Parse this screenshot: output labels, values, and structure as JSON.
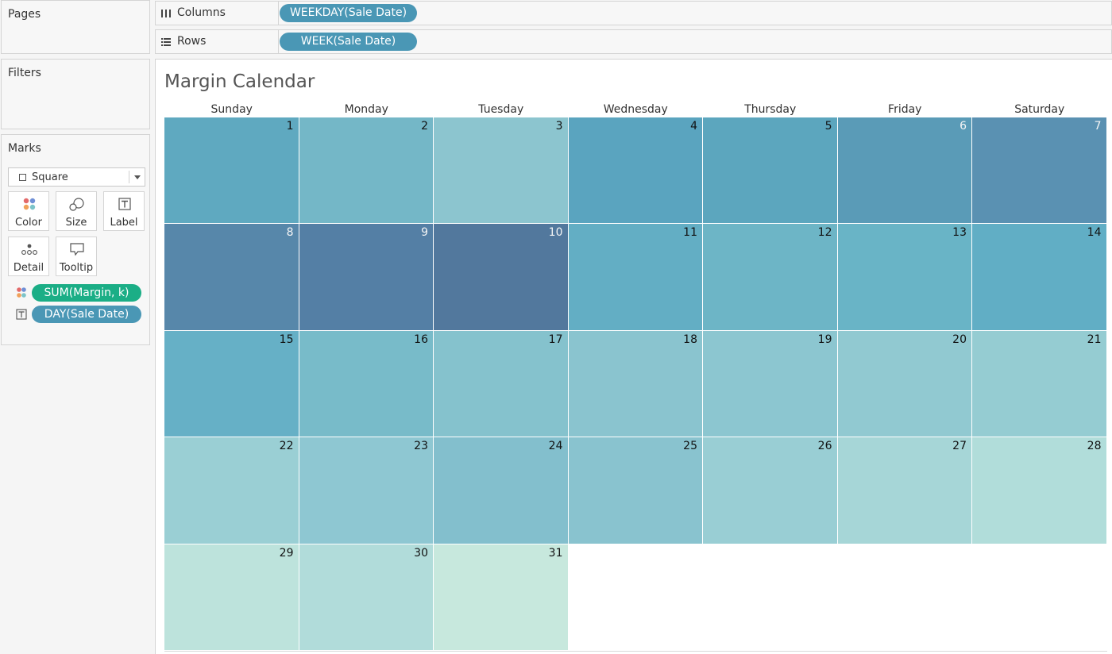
{
  "sidebar": {
    "pages_title": "Pages",
    "filters_title": "Filters",
    "marks_title": "Marks",
    "mark_type": "Square",
    "mark_buttons": [
      {
        "label": "Color",
        "icon": "color-dots-icon"
      },
      {
        "label": "Size",
        "icon": "size-circles-icon"
      },
      {
        "label": "Label",
        "icon": "label-t-icon"
      },
      {
        "label": "Detail",
        "icon": "detail-dots-icon"
      },
      {
        "label": "Tooltip",
        "icon": "tooltip-bubble-icon"
      }
    ],
    "mark_fields": [
      {
        "label": "SUM(Margin, k)",
        "icon": "color-dots-icon",
        "color": "#1bae86"
      },
      {
        "label": "DAY(Sale Date)",
        "icon": "label-t-icon",
        "color": "#4a97b5"
      }
    ]
  },
  "shelves": {
    "columns_label": "Columns",
    "columns_pill": "WEEKDAY(Sale Date)",
    "rows_label": "Rows",
    "rows_pill": "WEEK(Sale Date)"
  },
  "viz": {
    "title": "Margin Calendar",
    "weekdays": [
      "Sunday",
      "Monday",
      "Tuesday",
      "Wednesday",
      "Thursday",
      "Friday",
      "Saturday"
    ],
    "days": [
      {
        "day": "1",
        "color": "#5fa9c0"
      },
      {
        "day": "2",
        "color": "#74b7c7"
      },
      {
        "day": "3",
        "color": "#8cc5cf"
      },
      {
        "day": "4",
        "color": "#5aa4bf"
      },
      {
        "day": "5",
        "color": "#5ca6be"
      },
      {
        "day": "6",
        "color": "#5a9bb7"
      },
      {
        "day": "7",
        "color": "#5a91b2"
      },
      {
        "day": "8",
        "color": "#5787aa"
      },
      {
        "day": "9",
        "color": "#547fa5"
      },
      {
        "day": "10",
        "color": "#52789d"
      },
      {
        "day": "11",
        "color": "#63aec4"
      },
      {
        "day": "12",
        "color": "#6db5c6"
      },
      {
        "day": "13",
        "color": "#69b4c6"
      },
      {
        "day": "14",
        "color": "#61aec5"
      },
      {
        "day": "15",
        "color": "#66b0c6"
      },
      {
        "day": "16",
        "color": "#78bbc9"
      },
      {
        "day": "17",
        "color": "#85c2cd"
      },
      {
        "day": "18",
        "color": "#8ac4cf"
      },
      {
        "day": "19",
        "color": "#8cc6d0"
      },
      {
        "day": "20",
        "color": "#91c9d1"
      },
      {
        "day": "21",
        "color": "#95ccd2"
      },
      {
        "day": "22",
        "color": "#9acfd4"
      },
      {
        "day": "23",
        "color": "#8ec7d2"
      },
      {
        "day": "24",
        "color": "#83bfcd"
      },
      {
        "day": "25",
        "color": "#89c3cf"
      },
      {
        "day": "26",
        "color": "#99ced4"
      },
      {
        "day": "27",
        "color": "#a6d6d7"
      },
      {
        "day": "28",
        "color": "#b1ddda"
      },
      {
        "day": "29",
        "color": "#bde3dc"
      },
      {
        "day": "30",
        "color": "#b1dcda"
      },
      {
        "day": "31",
        "color": "#c7e8dd"
      }
    ],
    "dark_text_color": "#111111",
    "light_text_color": "#f5f5f5"
  }
}
